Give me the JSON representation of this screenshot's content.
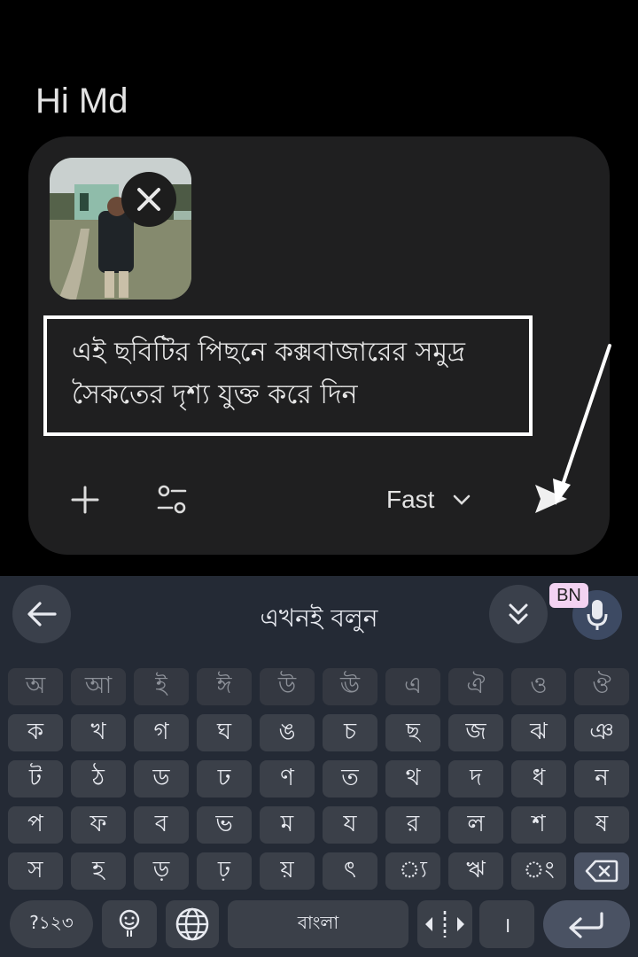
{
  "greeting": "Hi Md",
  "composer": {
    "prompt_text_line1": "এই ছবিটির পিছনে কক্সবাজারের সমুদ্র",
    "prompt_text_line2": "সৈকতের দৃশ্য যুক্ত করে দিন",
    "model_label": "Fast"
  },
  "keyboard": {
    "hint": "এখনই বলুন",
    "language_badge": "BN",
    "rows": [
      [
        "অ",
        "আ",
        "ই",
        "ঈ",
        "উ",
        "ঊ",
        "এ",
        "ঐ",
        "ও",
        "ঔ"
      ],
      [
        "ক",
        "খ",
        "গ",
        "ঘ",
        "ঙ",
        "চ",
        "ছ",
        "জ",
        "ঝ",
        "ঞ"
      ],
      [
        "ট",
        "ঠ",
        "ড",
        "ঢ",
        "ণ",
        "ত",
        "থ",
        "দ",
        "ধ",
        "ন"
      ],
      [
        "প",
        "ফ",
        "ব",
        "ভ",
        "ম",
        "য",
        "র",
        "ল",
        "শ",
        "ষ"
      ],
      [
        "স",
        "হ",
        "ড়",
        "ঢ়",
        "য়",
        "ৎ",
        "্য",
        "ঋ",
        "ং"
      ]
    ],
    "symbols_key": "?১২৩",
    "space_label": "বাংলা",
    "danda_key": "।"
  },
  "colors": {
    "background": "#000000",
    "composer_bg": "#1f1f20",
    "keyboard_bg": "#242a35",
    "key_bg": "#3b4049",
    "badge_bg": "#f3d3f2"
  }
}
